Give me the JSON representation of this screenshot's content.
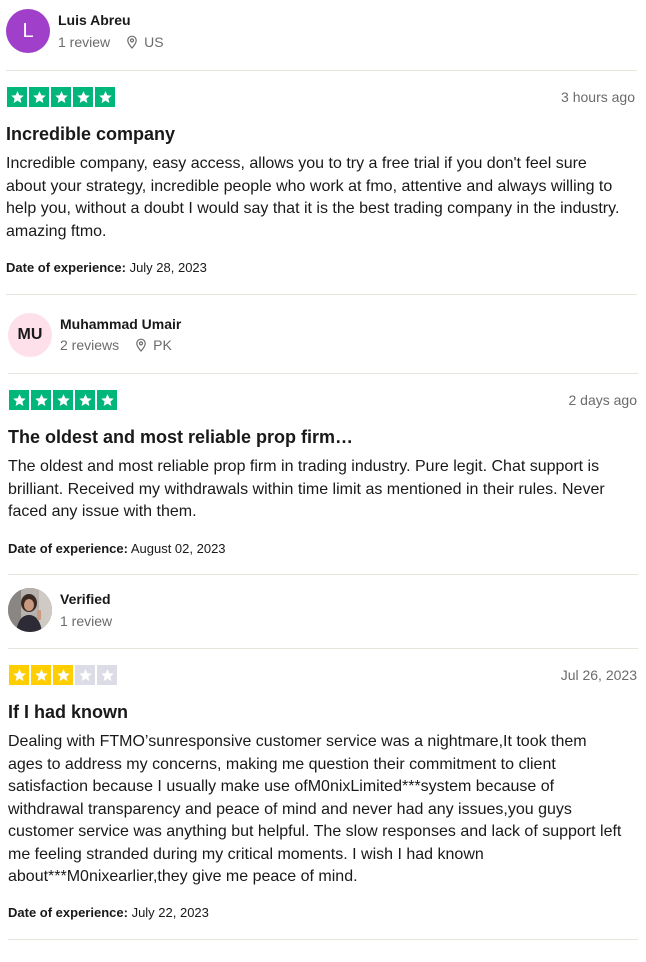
{
  "colors": {
    "star_green": "#00b67a",
    "star_yellow": "#ffce00",
    "star_empty": "#dcdce6",
    "avatar_purple": "#a03fc9",
    "avatar_pink": "#fde0ea"
  },
  "reviews": [
    {
      "reviewer_name": "Luis Abreu",
      "avatar_initials": "L",
      "review_count": "1 review",
      "country": "US",
      "rating": 5,
      "time": "3 hours ago",
      "title": "Incredible company",
      "body": "Incredible company, easy access, allows you to try a free trial if you don't feel sure about your strategy, incredible people who work at fmo, attentive and always willing to help you, without a doubt I would say that it is the best trading company in the industry. amazing ftmo.",
      "experience_label": "Date of experience:",
      "experience_date": "July 28, 2023"
    },
    {
      "reviewer_name": "Muhammad Umair",
      "avatar_initials": "MU",
      "review_count": "2 reviews",
      "country": "PK",
      "rating": 5,
      "time": "2 days ago",
      "title": "The oldest and most reliable prop firm…",
      "body": "The oldest and most reliable prop firm in trading industry. Pure legit. Chat support is brilliant. Received my withdrawals within time limit as mentioned in their rules. Never faced any issue with them.",
      "experience_label": "Date of experience:",
      "experience_date": "August 02, 2023"
    },
    {
      "reviewer_name": "Verified",
      "avatar_type": "photo",
      "review_count": "1 review",
      "rating": 3,
      "time": "Jul 26, 2023",
      "title": "If I had known",
      "body": "Dealing with FTMO’sunresponsive customer service was a nightmare,It took them ages to address my concerns, making me question their commitment to client satisfaction because I usually make use ofM0nixLimited***system because of withdrawal transparency and peace of mind and never had any issues,you guys customer service was anything but helpful. The slow responses and lack of support left me feeling stranded during my critical moments. I wish I had known about***M0nixearlier,they give me peace of mind.",
      "experience_label": "Date of experience:",
      "experience_date": "July 22, 2023"
    }
  ]
}
